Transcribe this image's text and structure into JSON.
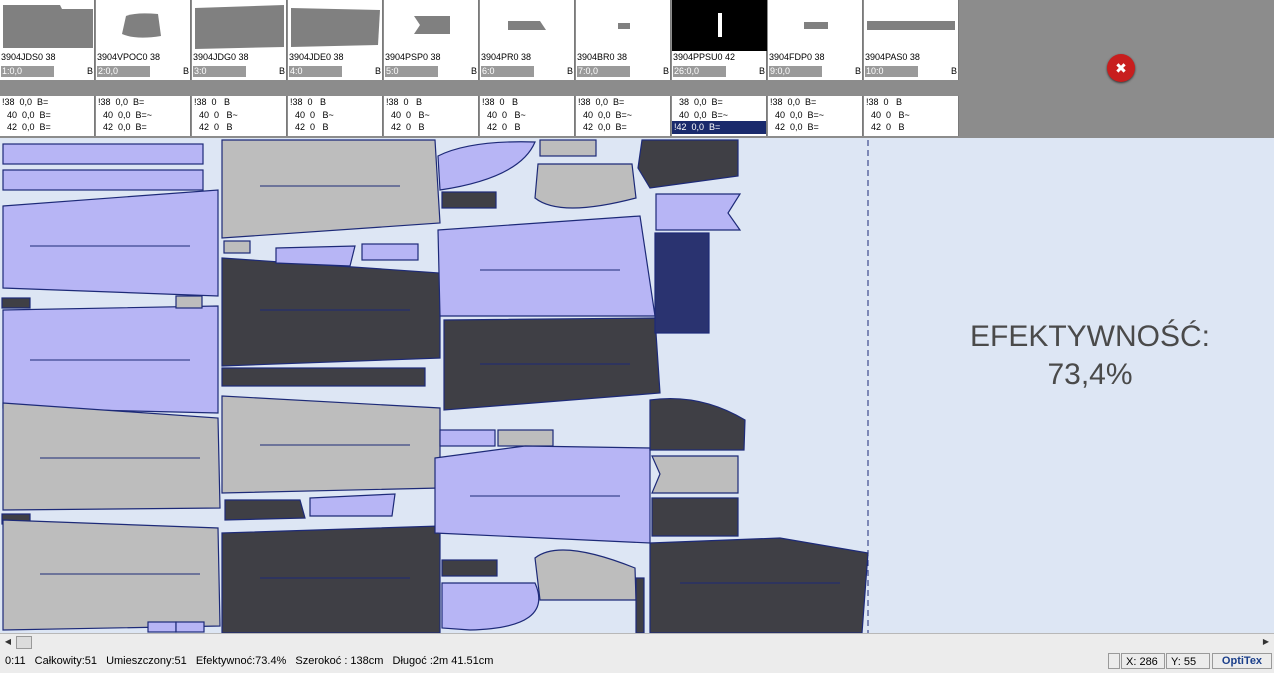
{
  "pieces": [
    {
      "name": "3904JDS0 38",
      "count": "1:0,0",
      "flag": "B"
    },
    {
      "name": "3904VPOC0 38",
      "count": "2:0,0",
      "flag": "B"
    },
    {
      "name": "3904JDG0 38",
      "count": "3:0",
      "flag": "B"
    },
    {
      "name": "3904JDE0 38",
      "count": "4:0",
      "flag": "B"
    },
    {
      "name": "3904PSP0 38",
      "count": "5:0",
      "flag": "B"
    },
    {
      "name": "3904PR0 38",
      "count": "6:0",
      "flag": "B"
    },
    {
      "name": "3904BR0 38",
      "count": "7:0,0",
      "flag": "B"
    },
    {
      "name": "3904PPSU0 42",
      "count": "26:0,0",
      "flag": "B"
    },
    {
      "name": "3904FDP0 38",
      "count": "9:0,0",
      "flag": "B"
    },
    {
      "name": "3904PAS0 38",
      "count": "10:0",
      "flag": "B"
    }
  ],
  "sizes": [
    [
      "!38  0,0  B=",
      "  40  0,0  B=",
      "  42  0,0  B="
    ],
    [
      "!38  0,0  B=",
      "  40  0,0  B=~",
      "  42  0,0  B="
    ],
    [
      "!38  0   B",
      "  40  0   B~",
      "  42  0   B"
    ],
    [
      "!38  0   B",
      "  40  0   B~",
      "  42  0   B"
    ],
    [
      "!38  0   B",
      "  40  0   B~",
      "  42  0   B"
    ],
    [
      "!38  0   B",
      "  40  0   B~",
      "  42  0   B"
    ],
    [
      "!38  0,0  B=",
      "  40  0,0  B=~",
      "  42  0,0  B="
    ],
    [
      "  38  0,0  B=",
      "  40  0,0  B=~",
      "!42  0,0  B="
    ],
    [
      "!38  0,0  B=",
      "  40  0,0  B=~",
      "  42  0,0  B="
    ],
    [
      "!38  0   B",
      "  40  0   B~",
      "  42  0   B"
    ]
  ],
  "marker": {
    "efficiency_label": "EFEKTYWNOŚĆ:",
    "efficiency_value": "73,4%"
  },
  "status": {
    "time": "0:11",
    "total": "Całkowity:51",
    "placed": "Umieszczony:51",
    "efficiency": "Efektywnoć:73.4%",
    "width": "Szerokoć : 138cm",
    "length": "Długoć :2m 41.51cm",
    "x": "X: 286",
    "y": "Y: 55",
    "logo": "OptiTex"
  },
  "icons": {
    "alarm": "thumbs-down-icon"
  },
  "colors": {
    "lavender": "#b7b5f5",
    "grey": "#bdbdbd",
    "dark": "#3f3f45",
    "outline": "#1d2a78",
    "bg": "#dde6f4"
  }
}
